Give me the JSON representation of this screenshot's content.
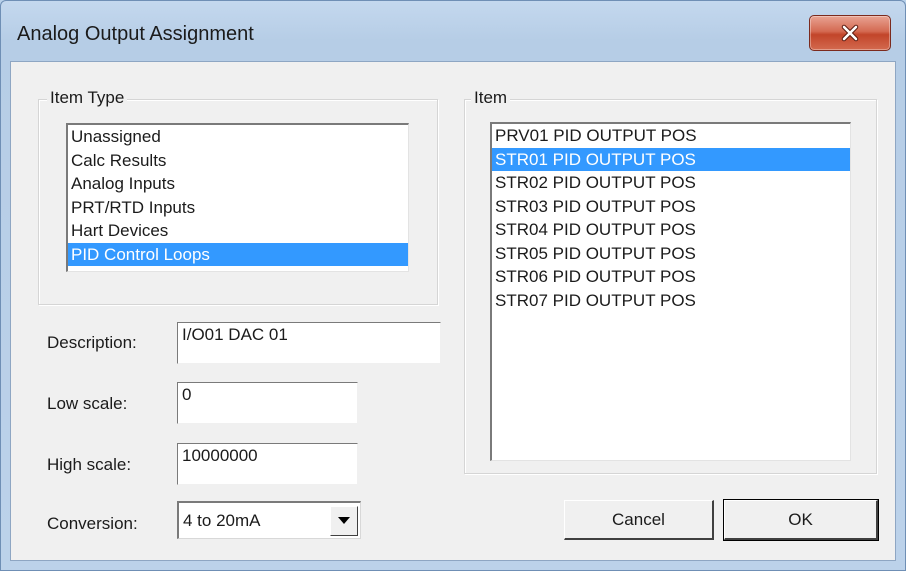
{
  "window": {
    "title": "Analog Output Assignment"
  },
  "item_type": {
    "label": "Item Type",
    "items": [
      "Unassigned",
      "Calc Results",
      "Analog Inputs",
      "PRT/RTD Inputs",
      "Hart Devices",
      "PID Control Loops"
    ],
    "selected": "PID Control Loops"
  },
  "item": {
    "label": "Item",
    "items": [
      "PRV01 PID OUTPUT POS",
      "STR01 PID OUTPUT POS",
      "STR02 PID OUTPUT POS",
      "STR03 PID OUTPUT POS",
      "STR04 PID OUTPUT POS",
      "STR05 PID OUTPUT POS",
      "STR06 PID OUTPUT POS",
      "STR07 PID OUTPUT POS"
    ],
    "selected": "STR01 PID OUTPUT POS"
  },
  "fields": {
    "description_label": "Description:",
    "description_value": "I/O01 DAC 01",
    "low_scale_label": "Low scale:",
    "low_scale_value": "0",
    "high_scale_label": "High scale:",
    "high_scale_value": "10000000",
    "conversion_label": "Conversion:",
    "conversion_value": "4 to 20mA"
  },
  "buttons": {
    "cancel": "Cancel",
    "ok": "OK"
  },
  "colors": {
    "selection": "#3399ff",
    "close_button": "#c8503a"
  },
  "icons": {
    "close": "close-icon",
    "dropdown": "chevron-down-icon"
  }
}
